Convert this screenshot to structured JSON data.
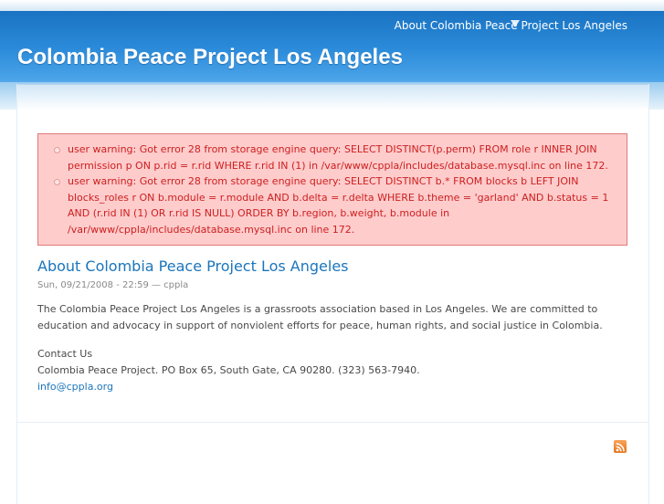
{
  "nav": {
    "primary_link": "About Colombia Peace Project Los Angeles"
  },
  "site": {
    "name": "Colombia Peace Project Los Angeles"
  },
  "messages": {
    "errors": [
      "user warning: Got error 28 from storage engine query: SELECT DISTINCT(p.perm) FROM role r INNER JOIN permission p ON p.rid = r.rid WHERE r.rid IN (1) in /var/www/cppla/includes/database.mysql.inc on line 172.",
      "user warning: Got error 28 from storage engine query: SELECT DISTINCT b.* FROM blocks b LEFT JOIN blocks_roles r ON b.module = r.module AND b.delta = r.delta WHERE b.theme = 'garland' AND b.status = 1 AND (r.rid IN (1) OR r.rid IS NULL) ORDER BY b.region, b.weight, b.module in /var/www/cppla/includes/database.mysql.inc on line 172."
    ]
  },
  "node": {
    "title": "About Colombia Peace Project Los Angeles",
    "submitted": "Sun, 09/21/2008 - 22:59 — cppla",
    "paragraph1": "The Colombia Peace Project Los Angeles is a grassroots association based in Los Angeles. We are committed to education and advocacy in support of nonviolent efforts for peace, human rights, and social justice in Colombia.",
    "contact_heading": "Contact Us",
    "contact_address": "Colombia Peace Project. PO Box 65, South Gate, CA 90280. (323) 563-7940.",
    "contact_email": "info@cppla.org"
  },
  "footer": {
    "icon": "rss-feed-icon"
  },
  "colors": {
    "header_blue": "#2a8ad9",
    "link_blue": "#1b75bb",
    "error_background": "#ffcccc",
    "error_text": "#cc1f1f",
    "feed_orange": "#e5741b"
  }
}
